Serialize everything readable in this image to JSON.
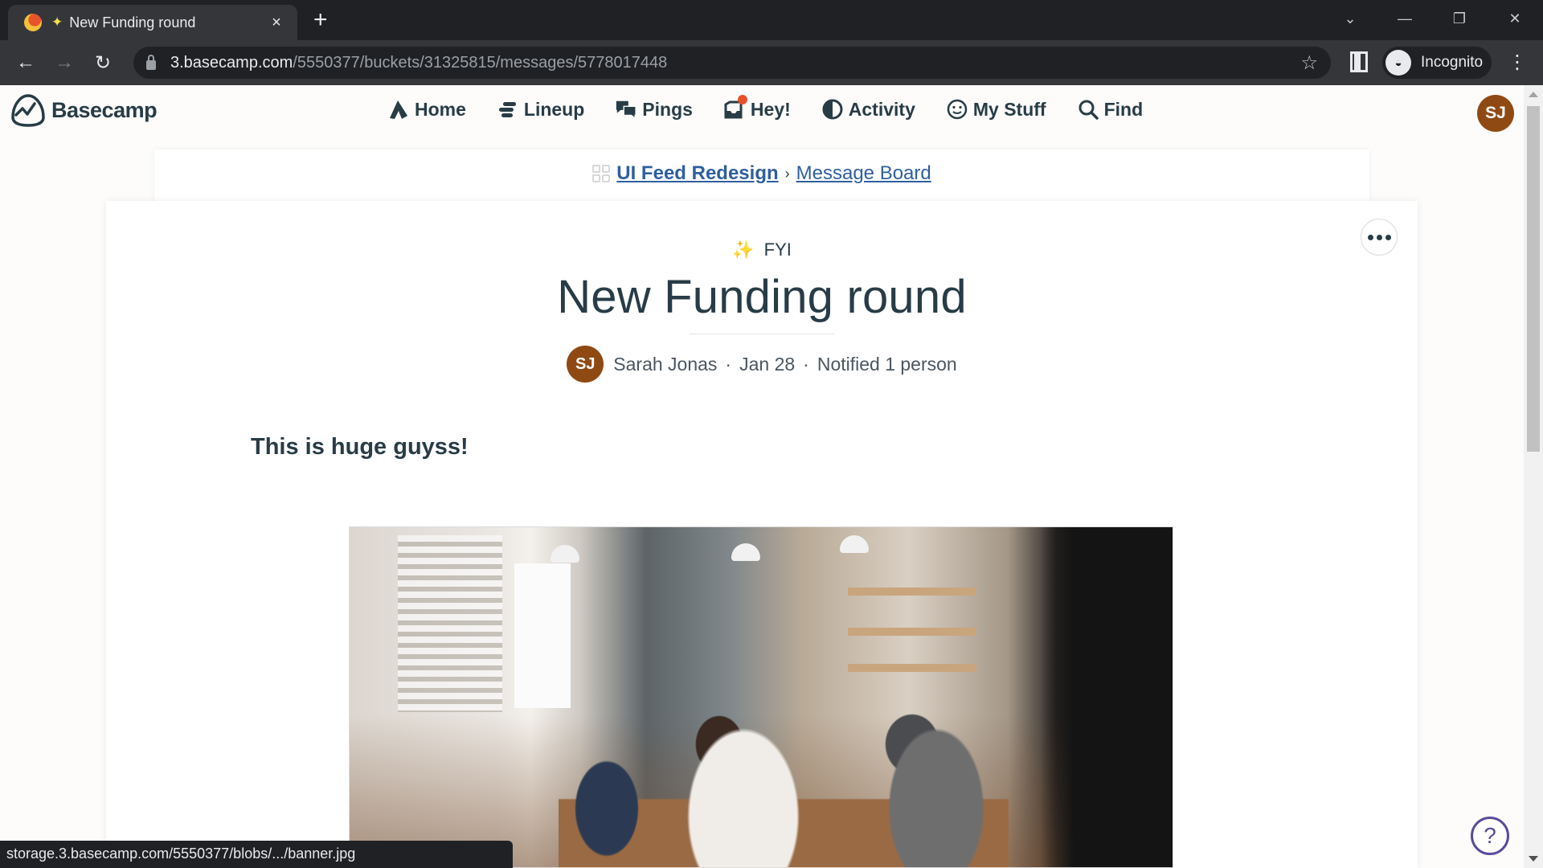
{
  "browser": {
    "tab": {
      "title": "New Funding round",
      "close_glyph": "×"
    },
    "new_tab_glyph": "+",
    "window_controls": {
      "tab_search": "⌄",
      "minimize": "—",
      "restore": "❐",
      "close": "✕"
    },
    "nav": {
      "back": "←",
      "forward": "→",
      "reload": "↻"
    },
    "url": {
      "host": "3.basecamp.com",
      "path": "/5550377/buckets/31325815/messages/5778017448"
    },
    "bookmark_glyph": "☆",
    "profile_label": "Incognito",
    "menu_glyph": "⋮",
    "status_url": "storage.3.basecamp.com/5550377/blobs/.../banner.jpg"
  },
  "app": {
    "brand": "Basecamp",
    "nav": [
      {
        "label": "Home",
        "icon": "home-icon"
      },
      {
        "label": "Lineup",
        "icon": "lineup-icon"
      },
      {
        "label": "Pings",
        "icon": "pings-icon"
      },
      {
        "label": "Hey!",
        "icon": "hey-inbox-icon",
        "has_badge": true
      },
      {
        "label": "Activity",
        "icon": "activity-icon"
      },
      {
        "label": "My Stuff",
        "icon": "my-stuff-icon"
      },
      {
        "label": "Find",
        "icon": "search-icon"
      }
    ],
    "user_initials": "SJ",
    "colors": {
      "brand_text": "#283c46",
      "avatar": "#8f4a14",
      "link": "#2f5f9e",
      "badge": "#e8512a",
      "help": "#5b4b9a"
    }
  },
  "breadcrumb": {
    "project": "UI Feed Redesign",
    "separator": "›",
    "section": "Message Board"
  },
  "message": {
    "category_emoji": "✨",
    "category": "FYI",
    "title": "New Funding round",
    "author_initials": "SJ",
    "author": "Sarah Jonas",
    "date": "Jan 28",
    "notified": "Notified 1 person",
    "byline_sep": "·",
    "body": "This is huge guyss!",
    "attachment": "banner.jpg"
  },
  "help_glyph": "?"
}
